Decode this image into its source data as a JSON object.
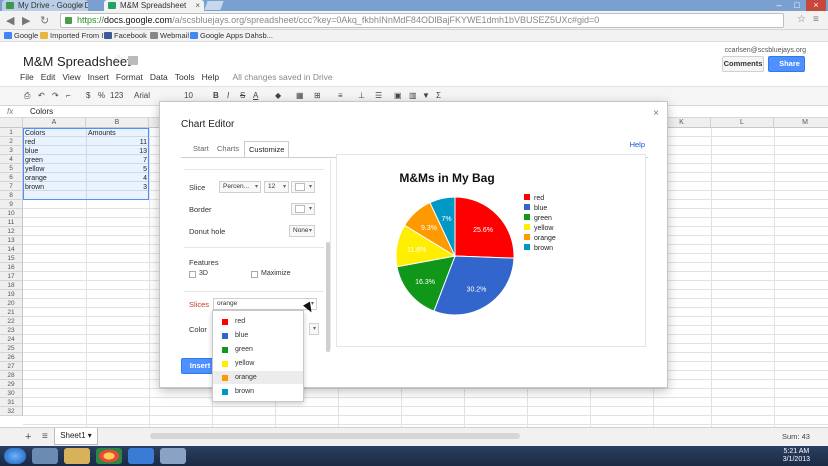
{
  "browser": {
    "tabs": [
      {
        "title": "My Drive - Google Drive",
        "active": false
      },
      {
        "title": "M&M Spreadsheet",
        "active": true
      }
    ],
    "url": {
      "scheme": "https://",
      "host": "docs.google.com",
      "path": "/a/scsbluejays.org/spreadsheet/ccc?key=0Akq_fkbhINnMdF84ODlBajFKYWE1dmh1bVBUSEZ5UXc#gid=0"
    },
    "bookmarks": [
      "Google",
      "Imported From IE",
      "Facebook",
      "Webmail",
      "Google Apps Dahsb..."
    ]
  },
  "doc": {
    "title": "M&M Spreadsheet",
    "user_email": "ccarlsen@scsbluejays.org",
    "comments_label": "Comments",
    "share_label": "Share",
    "menu": [
      "File",
      "Edit",
      "View",
      "Insert",
      "Format",
      "Data",
      "Tools",
      "Help"
    ],
    "save_status": "All changes saved in Drive"
  },
  "toolbar": {
    "currency": "$",
    "percent": "%",
    "number_format": "123",
    "font": "Arial",
    "font_size": "10",
    "bold": "B",
    "italic": "I",
    "strike": "S",
    "textcolor": "A"
  },
  "formula": {
    "fx": "fx",
    "value": "Colors"
  },
  "grid": {
    "columns": [
      "A",
      "B",
      "C",
      "D",
      "E",
      "F",
      "G",
      "H",
      "I",
      "J",
      "K",
      "L",
      "M"
    ],
    "rows": [
      "1",
      "2",
      "3",
      "4",
      "5",
      "6",
      "7",
      "8",
      "9",
      "10",
      "11",
      "12",
      "13",
      "14",
      "15",
      "16",
      "17",
      "18",
      "19",
      "20",
      "21",
      "22",
      "23",
      "24",
      "25",
      "26",
      "27",
      "28",
      "29",
      "30",
      "31",
      "32"
    ],
    "header": [
      "Colors",
      "Amounts"
    ],
    "data": [
      [
        "red",
        "11"
      ],
      [
        "blue",
        "13"
      ],
      [
        "green",
        "7"
      ],
      [
        "yellow",
        "5"
      ],
      [
        "orange",
        "4"
      ],
      [
        "brown",
        "3"
      ]
    ]
  },
  "sheets": {
    "add": "+",
    "list": "≡",
    "active": "Sheet1",
    "sum": "Sum: 43"
  },
  "dialog": {
    "title": "Chart Editor",
    "close": "×",
    "help": "Help",
    "tabs": [
      "Start",
      "Charts",
      "Customize"
    ],
    "active_tab": "Customize",
    "slice_label": "Slice",
    "slice_format": "Percen...",
    "slice_size": "12",
    "border_label": "Border",
    "donut_label": "Donut hole",
    "donut_value": "None",
    "features_label": "Features",
    "feature_3d": "3D",
    "feature_maximize": "Maximize",
    "slices_label": "Slices",
    "slices_value": "orange",
    "color_label": "Color",
    "insert_label": "Insert"
  },
  "slice_options": [
    {
      "label": "red",
      "color": "#ff0000"
    },
    {
      "label": "blue",
      "color": "#3366cc"
    },
    {
      "label": "green",
      "color": "#109618"
    },
    {
      "label": "yellow",
      "color": "#ffee00"
    },
    {
      "label": "orange",
      "color": "#ff9900"
    },
    {
      "label": "brown",
      "color": "#0099c6"
    }
  ],
  "chart_data": {
    "type": "pie",
    "title": "M&Ms in My Bag",
    "categories": [
      "red",
      "blue",
      "green",
      "yellow",
      "orange",
      "brown"
    ],
    "values": [
      11,
      13,
      7,
      5,
      4,
      3
    ],
    "labels": [
      "25.6%",
      "30.2%",
      "16.3%",
      "11.6%",
      "9.3%",
      "7%"
    ],
    "colors": [
      "#ff0000",
      "#3366cc",
      "#109618",
      "#ffee00",
      "#ff9900",
      "#0099c6"
    ],
    "legend_position": "right"
  },
  "taskbar": {
    "time": "5:21 AM",
    "date": "3/1/2013"
  }
}
